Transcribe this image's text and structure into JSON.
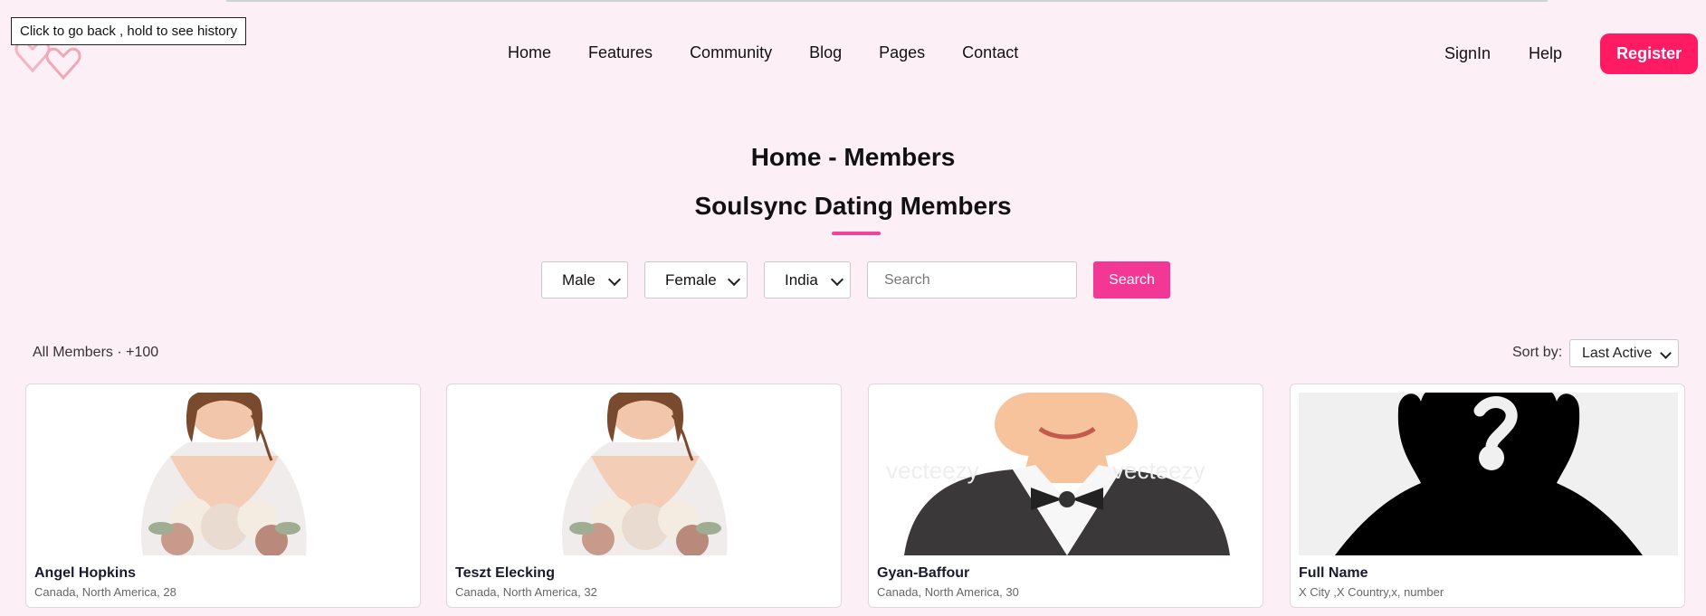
{
  "tooltip": "Click to go back , hold to see history",
  "nav": {
    "items": [
      "Home",
      "Features",
      "Community",
      "Blog",
      "Pages",
      "Contact"
    ],
    "signin": "SignIn",
    "help": "Help",
    "register": "Register"
  },
  "heading": {
    "breadcrumb": "Home - Members",
    "title": "Soulsync Dating Members"
  },
  "filters": {
    "gender1": "Male",
    "gender2": "Female",
    "country": "India",
    "search_placeholder": "Search",
    "search_button": "Search"
  },
  "members_bar": {
    "all_members": "All Members · +100",
    "sort_label": "Sort by:",
    "sort_value": "Last Active"
  },
  "cards": [
    {
      "name": "Angel Hopkins",
      "location": "Canada, North America, 28",
      "image": "bride"
    },
    {
      "name": "Teszt Elecking",
      "location": "Canada, North America, 32",
      "image": "bride"
    },
    {
      "name": "Gyan-Baffour",
      "location": "Canada, North America, 30",
      "image": "groom"
    },
    {
      "name": "Full Name",
      "location": "X City ,X Country,x, number",
      "image": "unknown-silhouette"
    }
  ],
  "colors": {
    "background": "#fdeff6",
    "accent": "#fe1b64",
    "search_button": "#f23795"
  }
}
